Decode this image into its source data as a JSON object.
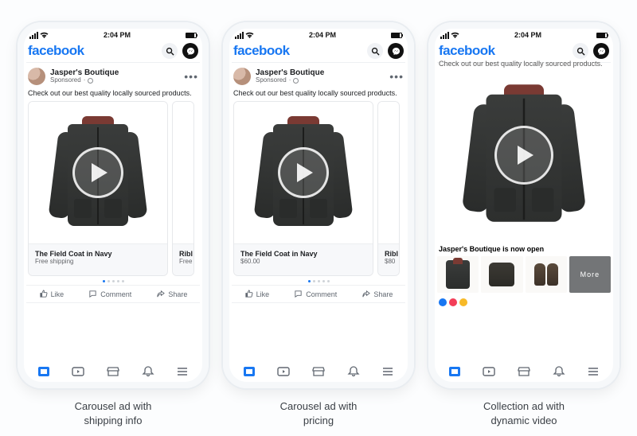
{
  "status": {
    "time": "2:04 PM",
    "carrier_icon": "signal",
    "wifi_icon": "wifi",
    "battery_icon": "battery"
  },
  "header": {
    "logo": "facebook",
    "search_icon": "search",
    "messenger_icon": "messenger"
  },
  "post": {
    "advertiser": "Jasper's Boutique",
    "sponsored": "Sponsored",
    "body": "Check out our best quality locally sourced products.",
    "more": "•••"
  },
  "card1": {
    "title": "The Field Coat in Navy",
    "sub": "Free shipping",
    "peek_title": "Ribl",
    "peek_sub": "Free"
  },
  "card2": {
    "title": "The Field Coat in Navy",
    "sub": "$60.00",
    "peek_title": "Ribl",
    "peek_sub": "$80"
  },
  "collection": {
    "title": "Jasper's Boutique is now open",
    "more_label": "More"
  },
  "actions": {
    "like": "Like",
    "comment": "Comment",
    "share": "Share"
  },
  "captions": {
    "c1a": "Carousel ad with",
    "c1b": "shipping info",
    "c2a": "Carousel ad with",
    "c2b": "pricing",
    "c3a": "Collection ad with",
    "c3b": "dynamic video"
  }
}
